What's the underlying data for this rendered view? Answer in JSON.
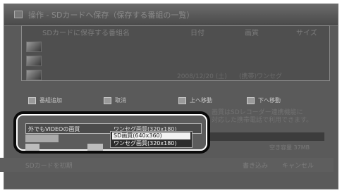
{
  "title": "操作 - SDカードへ保存（保存する番組の一覧）",
  "list": {
    "column_headers": [
      "SDカードに保存する番組名",
      "日付",
      "画質",
      "サイズ"
    ],
    "rows": [
      {
        "name": "",
        "date": "",
        "quality": "",
        "size": ""
      },
      {
        "name": "",
        "date": "",
        "quality": "",
        "size": ""
      },
      {
        "name": "",
        "date": "2008/12/20 (土)",
        "quality": "(携帯)ワンセグ",
        "size": ""
      }
    ]
  },
  "buttons": {
    "add_label": "番組追加",
    "delete_label": "取消",
    "up_label": "上へ移動",
    "down_label": "下へ移動"
  },
  "info_text": "画質はSDレコーダー連携機能に\n対応した携帯電話で利用できます。",
  "quality_setting": {
    "label": "外でもVIDEOの画質",
    "value": "ワンセグ画質(320x180)",
    "options": [
      "SD画質(640x360)",
      "ワンセグ画質(320x180)"
    ],
    "highlighted_index": 0
  },
  "free_space": "空き容量 37MB",
  "footer": {
    "left_label": "SDカードを初期",
    "write_label": "書き込み",
    "cancel_label": "キャンセル"
  },
  "colors": {
    "highlight_outline": "#0a0a0a",
    "panel_bg": "#5a5a5a"
  }
}
